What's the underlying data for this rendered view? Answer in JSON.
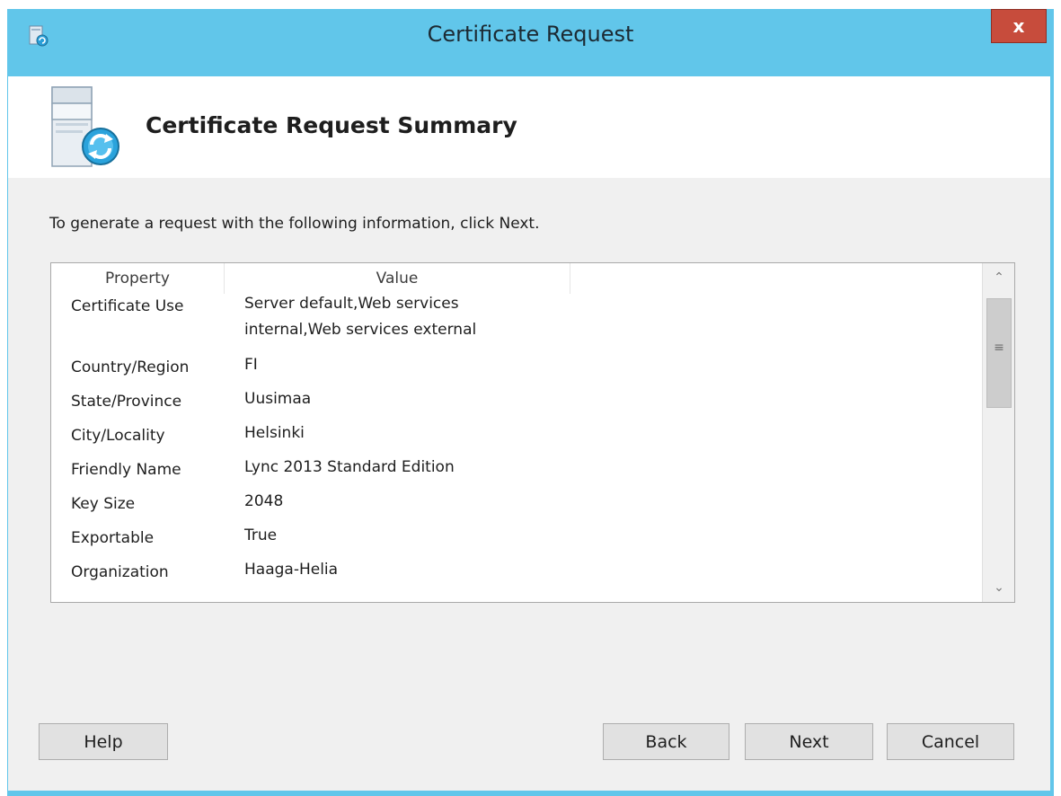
{
  "window": {
    "title": "Certificate Request",
    "close_label": "x"
  },
  "header": {
    "title": "Certificate Request Summary"
  },
  "instruction": "To generate a request with the following information, click Next.",
  "table": {
    "columns": [
      "Property",
      "Value",
      ""
    ],
    "rows": [
      {
        "property": "Certificate Use",
        "value": "Server default,Web services\ninternal,Web services external"
      },
      {
        "property": "Country/Region",
        "value": "FI"
      },
      {
        "property": "State/Province",
        "value": "Uusimaa"
      },
      {
        "property": "City/Locality",
        "value": "Helsinki"
      },
      {
        "property": "Friendly Name",
        "value": "Lync 2013 Standard Edition"
      },
      {
        "property": "Key Size",
        "value": "2048"
      },
      {
        "property": "Exportable",
        "value": "True"
      },
      {
        "property": "Organization",
        "value": "Haaga-Helia"
      }
    ]
  },
  "buttons": {
    "help": "Help",
    "back": "Back",
    "next": "Next",
    "cancel": "Cancel"
  },
  "colors": {
    "frame": "#61c6ea",
    "close": "#c74c3c",
    "client": "#f0f0f0"
  },
  "icons": {
    "title": "certificate-wizard-icon",
    "header": "certificate-request-icon",
    "scroll_up": "chevron-up-icon",
    "scroll_down": "chevron-down-icon"
  }
}
